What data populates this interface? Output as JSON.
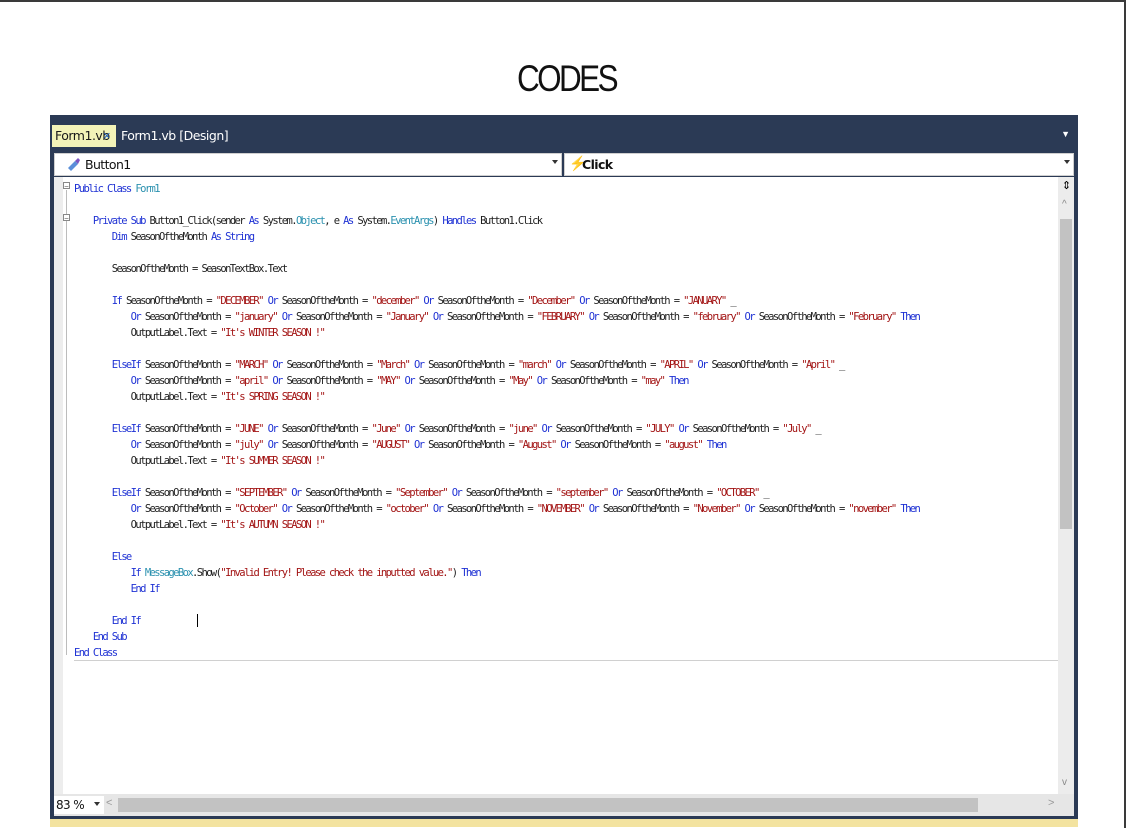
{
  "page": {
    "heading": "CODES"
  },
  "tabs": [
    {
      "label": "Form1.vb",
      "active": true,
      "close_icon": "×"
    },
    {
      "label": "Form1.vb [Design]",
      "active": false
    }
  ],
  "nav": {
    "object_dropdown": "Button1",
    "event_dropdown": "Click"
  },
  "code_lines": [
    [
      [
        "kw",
        "Public Class "
      ],
      [
        "typ",
        "Form1"
      ]
    ],
    [],
    [
      [
        "kw",
        "    Private Sub "
      ],
      [
        "t",
        "Button1_Click(sender "
      ],
      [
        "kw",
        "As "
      ],
      [
        "t",
        "System."
      ],
      [
        "typ",
        "Object"
      ],
      [
        "t",
        ", e "
      ],
      [
        "kw",
        "As "
      ],
      [
        "t",
        "System."
      ],
      [
        "typ",
        "EventArgs"
      ],
      [
        "t",
        ") "
      ],
      [
        "kw",
        "Handles "
      ],
      [
        "t",
        "Button1.Click"
      ]
    ],
    [
      [
        "kw",
        "        Dim "
      ],
      [
        "t",
        "SeasonOftheMonth "
      ],
      [
        "kw",
        "As String"
      ]
    ],
    [],
    [
      [
        "t",
        "        SeasonOftheMonth = SeasonTextBox.Text"
      ]
    ],
    [],
    [
      [
        "kw",
        "        If "
      ],
      [
        "t",
        "SeasonOftheMonth = "
      ],
      [
        "str",
        "\"DECEMBER\""
      ],
      [
        "kw",
        " Or "
      ],
      [
        "t",
        "SeasonOftheMonth = "
      ],
      [
        "str",
        "\"december\""
      ],
      [
        "kw",
        " Or "
      ],
      [
        "t",
        "SeasonOftheMonth = "
      ],
      [
        "str",
        "\"December\""
      ],
      [
        "kw",
        " Or "
      ],
      [
        "t",
        "SeasonOftheMonth = "
      ],
      [
        "str",
        "\"JANUARY\""
      ],
      [
        "t",
        " _"
      ]
    ],
    [
      [
        "kw",
        "            Or "
      ],
      [
        "t",
        "SeasonOftheMonth = "
      ],
      [
        "str",
        "\"january\""
      ],
      [
        "kw",
        " Or "
      ],
      [
        "t",
        "SeasonOftheMonth = "
      ],
      [
        "str",
        "\"January\""
      ],
      [
        "kw",
        " Or "
      ],
      [
        "t",
        "SeasonOftheMonth = "
      ],
      [
        "str",
        "\"FEBRUARY\""
      ],
      [
        "kw",
        " Or "
      ],
      [
        "t",
        "SeasonOftheMonth = "
      ],
      [
        "str",
        "\"february\""
      ],
      [
        "kw",
        " Or "
      ],
      [
        "t",
        "SeasonOftheMonth = "
      ],
      [
        "str",
        "\"February\""
      ],
      [
        "kw",
        " Then"
      ]
    ],
    [
      [
        "t",
        "            OutputLabel.Text = "
      ],
      [
        "str",
        "\"It's WINTER SEASON !\""
      ]
    ],
    [],
    [
      [
        "kw",
        "        ElseIf "
      ],
      [
        "t",
        "SeasonOftheMonth = "
      ],
      [
        "str",
        "\"MARCH\""
      ],
      [
        "kw",
        " Or "
      ],
      [
        "t",
        "SeasonOftheMonth = "
      ],
      [
        "str",
        "\"March\""
      ],
      [
        "kw",
        " Or "
      ],
      [
        "t",
        "SeasonOftheMonth = "
      ],
      [
        "str",
        "\"march\""
      ],
      [
        "kw",
        " Or "
      ],
      [
        "t",
        "SeasonOftheMonth = "
      ],
      [
        "str",
        "\"APRIL\""
      ],
      [
        "kw",
        " Or "
      ],
      [
        "t",
        "SeasonOftheMonth = "
      ],
      [
        "str",
        "\"April\""
      ],
      [
        "t",
        " _"
      ]
    ],
    [
      [
        "kw",
        "            Or "
      ],
      [
        "t",
        "SeasonOftheMonth = "
      ],
      [
        "str",
        "\"april\""
      ],
      [
        "kw",
        " Or "
      ],
      [
        "t",
        "SeasonOftheMonth = "
      ],
      [
        "str",
        "\"MAY\""
      ],
      [
        "kw",
        " Or "
      ],
      [
        "t",
        "SeasonOftheMonth = "
      ],
      [
        "str",
        "\"May\""
      ],
      [
        "kw",
        " Or "
      ],
      [
        "t",
        "SeasonOftheMonth = "
      ],
      [
        "str",
        "\"may\""
      ],
      [
        "kw",
        " Then"
      ]
    ],
    [
      [
        "t",
        "            OutputLabel.Text = "
      ],
      [
        "str",
        "\"It's SPRING SEASON !\""
      ]
    ],
    [],
    [
      [
        "kw",
        "        ElseIf "
      ],
      [
        "t",
        "SeasonOftheMonth = "
      ],
      [
        "str",
        "\"JUNE\""
      ],
      [
        "kw",
        " Or "
      ],
      [
        "t",
        "SeasonOftheMonth = "
      ],
      [
        "str",
        "\"June\""
      ],
      [
        "kw",
        " Or "
      ],
      [
        "t",
        "SeasonOftheMonth = "
      ],
      [
        "str",
        "\"june\""
      ],
      [
        "kw",
        " Or "
      ],
      [
        "t",
        "SeasonOftheMonth = "
      ],
      [
        "str",
        "\"JULY\""
      ],
      [
        "kw",
        " Or "
      ],
      [
        "t",
        "SeasonOftheMonth = "
      ],
      [
        "str",
        "\"July\""
      ],
      [
        "t",
        " _"
      ]
    ],
    [
      [
        "kw",
        "            Or "
      ],
      [
        "t",
        "SeasonOftheMonth = "
      ],
      [
        "str",
        "\"july\""
      ],
      [
        "kw",
        " Or "
      ],
      [
        "t",
        "SeasonOftheMonth = "
      ],
      [
        "str",
        "\"AUGUST\""
      ],
      [
        "kw",
        " Or "
      ],
      [
        "t",
        "SeasonOftheMonth = "
      ],
      [
        "str",
        "\"August\""
      ],
      [
        "kw",
        " Or "
      ],
      [
        "t",
        "SeasonOftheMonth = "
      ],
      [
        "str",
        "\"august\""
      ],
      [
        "kw",
        " Then"
      ]
    ],
    [
      [
        "t",
        "            OutputLabel.Text = "
      ],
      [
        "str",
        "\"It's SUMMER SEASON !\""
      ]
    ],
    [],
    [
      [
        "kw",
        "        ElseIf "
      ],
      [
        "t",
        "SeasonOftheMonth = "
      ],
      [
        "str",
        "\"SEPTEMBER\""
      ],
      [
        "kw",
        " Or "
      ],
      [
        "t",
        "SeasonOftheMonth = "
      ],
      [
        "str",
        "\"September\""
      ],
      [
        "kw",
        " Or "
      ],
      [
        "t",
        "SeasonOftheMonth = "
      ],
      [
        "str",
        "\"september\""
      ],
      [
        "kw",
        " Or "
      ],
      [
        "t",
        "SeasonOftheMonth = "
      ],
      [
        "str",
        "\"OCTOBER\""
      ],
      [
        "t",
        " _"
      ]
    ],
    [
      [
        "kw",
        "            Or "
      ],
      [
        "t",
        "SeasonOftheMonth = "
      ],
      [
        "str",
        "\"October\""
      ],
      [
        "kw",
        " Or "
      ],
      [
        "t",
        "SeasonOftheMonth = "
      ],
      [
        "str",
        "\"october\""
      ],
      [
        "kw",
        " Or "
      ],
      [
        "t",
        "SeasonOftheMonth = "
      ],
      [
        "str",
        "\"NOVEMBER\""
      ],
      [
        "kw",
        " Or "
      ],
      [
        "t",
        "SeasonOftheMonth = "
      ],
      [
        "str",
        "\"November\""
      ],
      [
        "kw",
        " Or "
      ],
      [
        "t",
        "SeasonOftheMonth = "
      ],
      [
        "str",
        "\"november\""
      ],
      [
        "kw",
        " Then"
      ]
    ],
    [
      [
        "t",
        "            OutputLabel.Text = "
      ],
      [
        "str",
        "\"It's AUTUMN SEASON !\""
      ]
    ],
    [],
    [
      [
        "kw",
        "        Else"
      ]
    ],
    [
      [
        "kw",
        "            If "
      ],
      [
        "typ",
        "MessageBox"
      ],
      [
        "t",
        ".Show("
      ],
      [
        "str",
        "\"Invalid Entry! Please check the inputted value.\""
      ],
      [
        "t",
        ") "
      ],
      [
        "kw",
        "Then"
      ]
    ],
    [
      [
        "kw",
        "            End If"
      ]
    ],
    [],
    [
      [
        "kw",
        "        End If"
      ]
    ],
    [
      [
        "kw",
        "    End Sub"
      ]
    ],
    [
      [
        "kw",
        "End Class"
      ]
    ]
  ],
  "status": {
    "zoom": "83 %"
  },
  "colors": {
    "ide_frame": "#2b3a55",
    "keyword": "#1f32d4",
    "string": "#a31515",
    "type": "#2b91af",
    "active_tab": "#f3f3b8"
  },
  "icons": {
    "object_icon": "button-object-icon",
    "event_icon": "lightning-event-icon"
  }
}
